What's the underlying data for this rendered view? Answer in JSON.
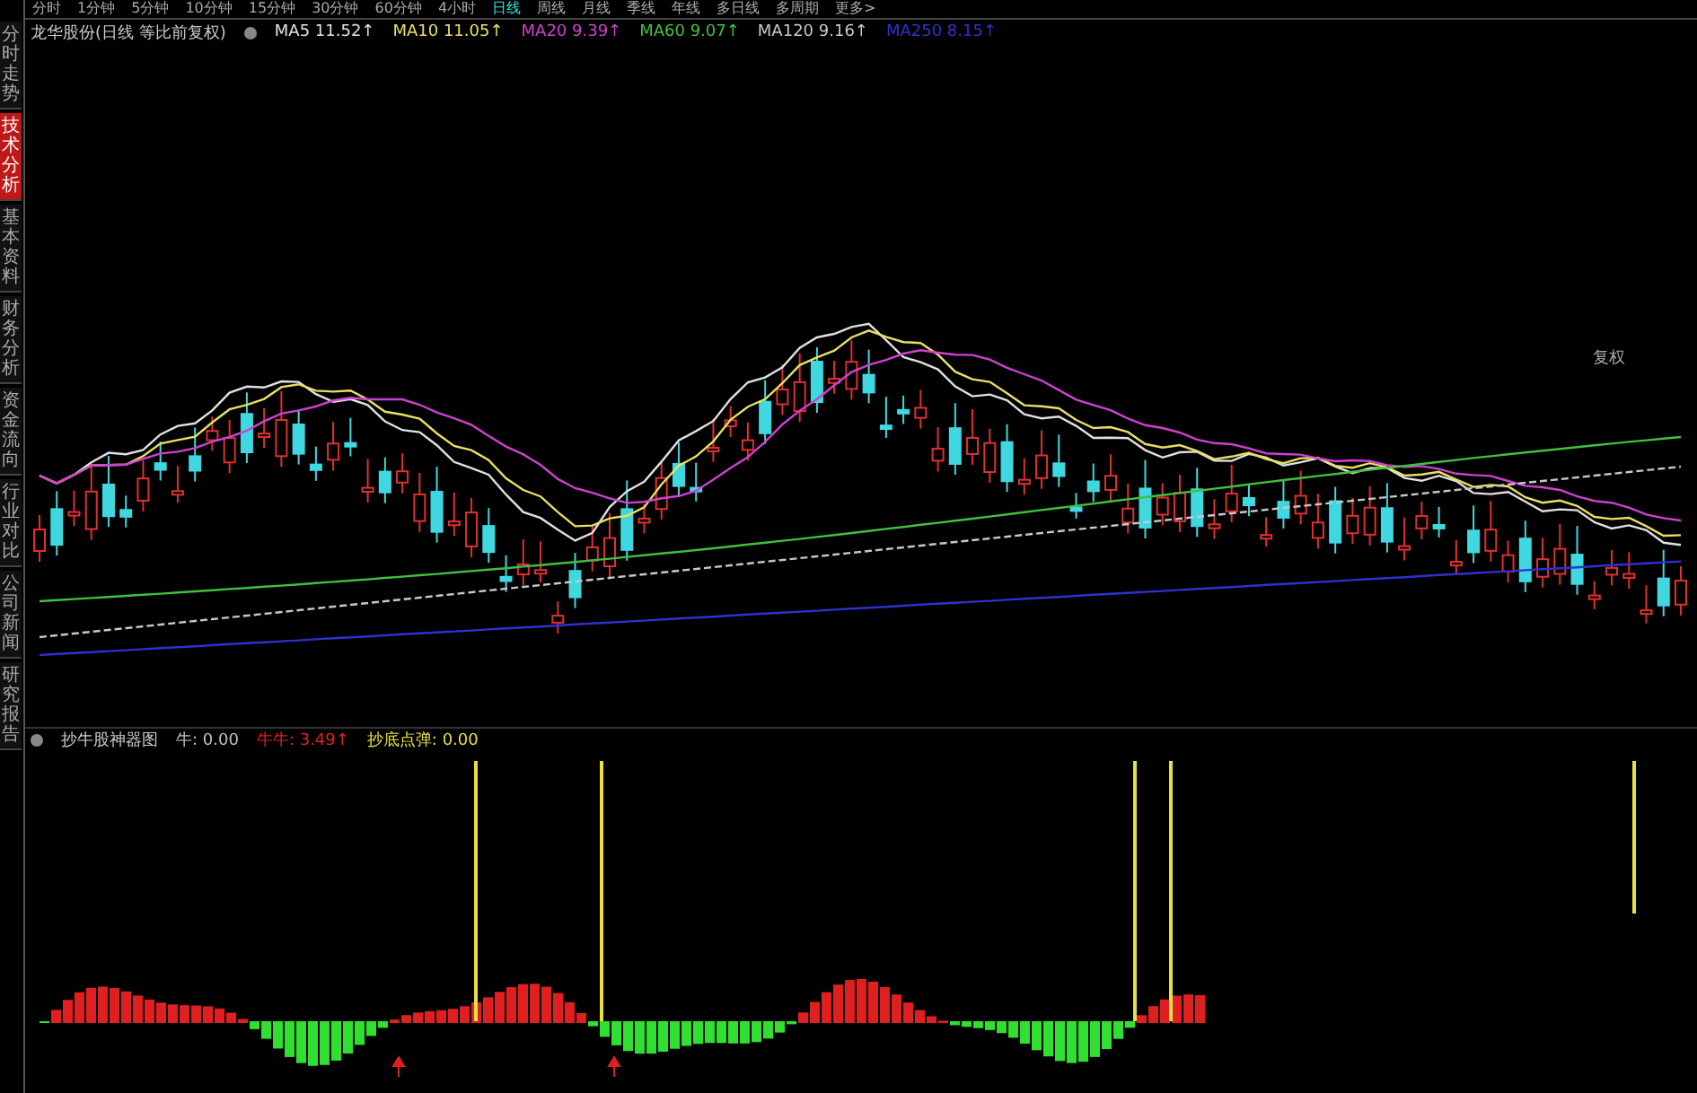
{
  "period_tabs": [
    {
      "label": "分时",
      "selected": false
    },
    {
      "label": "1分钟",
      "selected": false
    },
    {
      "label": "5分钟",
      "selected": false
    },
    {
      "label": "10分钟",
      "selected": false
    },
    {
      "label": "15分钟",
      "selected": false
    },
    {
      "label": "30分钟",
      "selected": false
    },
    {
      "label": "60分钟",
      "selected": false
    },
    {
      "label": "4小时",
      "selected": false
    },
    {
      "label": "日线",
      "selected": true
    },
    {
      "label": "周线",
      "selected": false
    },
    {
      "label": "月线",
      "selected": false
    },
    {
      "label": "季线",
      "selected": false
    },
    {
      "label": "年线",
      "selected": false
    },
    {
      "label": "多日线",
      "selected": false
    },
    {
      "label": "多周期",
      "selected": false
    },
    {
      "label": "更多>",
      "selected": false
    }
  ],
  "side_tabs": [
    {
      "label": "分时走势",
      "selected": false
    },
    {
      "label": "技术分析",
      "selected": true
    },
    {
      "label": "基本资料",
      "selected": false
    },
    {
      "label": "财务分析",
      "selected": false
    },
    {
      "label": "资金流向",
      "selected": false
    },
    {
      "label": "行业对比",
      "selected": false
    },
    {
      "label": "公司新闻",
      "selected": false
    },
    {
      "label": "研究报告",
      "selected": false
    }
  ],
  "price_legend": {
    "title": "龙华股份(日线 等比前复权)",
    "lines": [
      {
        "label": "MA5 11.52↑",
        "color": "#e0e0e0"
      },
      {
        "label": "MA10 11.05↑",
        "color": "#e8e060"
      },
      {
        "label": "MA20 9.39↑",
        "color": "#d040d0"
      },
      {
        "label": "MA60 9.07↑",
        "color": "#40c040"
      },
      {
        "label": "MA120 9.16↑",
        "color": "#c8c8c8"
      },
      {
        "label": "MA250 8.15↑",
        "color": "#3030d0"
      }
    ]
  },
  "right_label": "复权",
  "indicator_legend": {
    "title": "抄牛股神器图",
    "values": [
      {
        "label": "牛: 0.00",
        "color": "#c0c0c0"
      },
      {
        "label": "牛牛: 3.49↑",
        "color": "#e02020"
      },
      {
        "label": "抄底点弹: 0.00",
        "color": "#e8e040"
      }
    ]
  }
}
